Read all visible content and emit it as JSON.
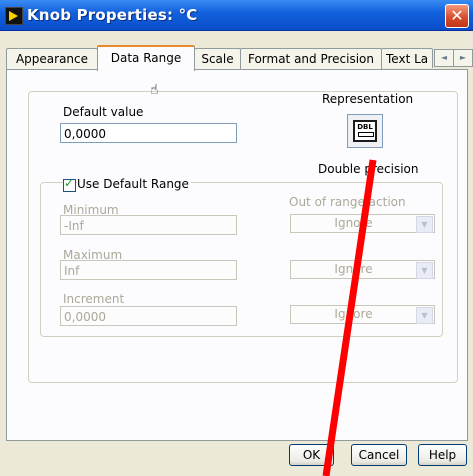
{
  "window": {
    "title": "Knob Properties: °C",
    "close_glyph": "✕"
  },
  "tabs": [
    {
      "label": "Appearance",
      "active": false
    },
    {
      "label": "Data Range",
      "active": true
    },
    {
      "label": "Scale",
      "active": false
    },
    {
      "label": "Format and Precision",
      "active": false
    },
    {
      "label": "Text La",
      "active": false
    }
  ],
  "tab_scroll": {
    "left": "◄",
    "right": "►"
  },
  "default_value": {
    "label": "Default value",
    "value": "0,0000"
  },
  "representation": {
    "label": "Representation",
    "icon_text": "DBL",
    "caption": "Double precision"
  },
  "use_default_range": {
    "label": "Use Default Range",
    "checked": true
  },
  "minimum": {
    "label": "Minimum",
    "value": "-Inf"
  },
  "maximum": {
    "label": "Maximum",
    "value": "Inf"
  },
  "increment": {
    "label": "Increment",
    "value": "0,0000"
  },
  "out_of_range": {
    "label": "Out of range action",
    "minimum_action": "Ignore",
    "maximum_action": "Ignore",
    "increment_action": "Ignore"
  },
  "buttons": {
    "ok": "OK",
    "cancel": "Cancel",
    "help": "Help"
  },
  "colors": {
    "titlebar": "#0a4cc8",
    "annotation": "#ff0000",
    "active_tab_accent": "#e68b2c"
  }
}
